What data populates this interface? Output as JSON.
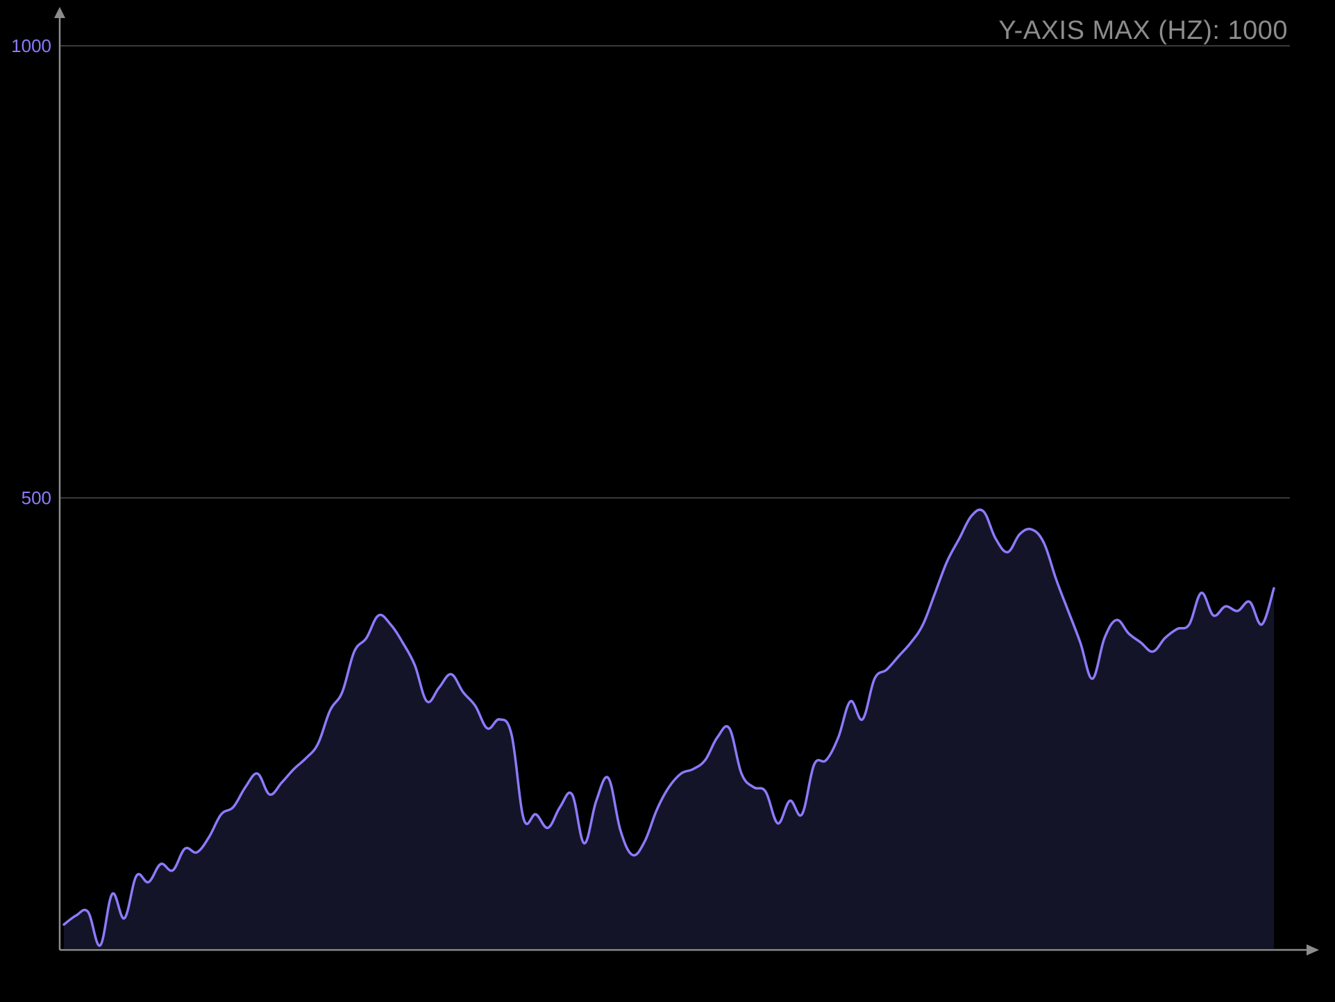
{
  "chart_data": {
    "type": "line",
    "title": "",
    "xlabel": "",
    "ylabel": "",
    "ylim": [
      0,
      1000
    ],
    "yticks": [
      500,
      1000
    ],
    "ytick_labels": [
      "500",
      "1000"
    ],
    "grid": true,
    "legend": "none",
    "annotation": "Y-AXIS MAX (HZ): 1000",
    "colors": {
      "line": "#8b7bff",
      "fill": "#141428",
      "grid": "#3a3a3a",
      "axis": "#8c8c8c",
      "tick_label": "#8b7bff",
      "annotation": "#8c8c8c",
      "background": "#000000"
    },
    "x": [
      0,
      4,
      8,
      12,
      16,
      20,
      24,
      28,
      32,
      36,
      40,
      44,
      48,
      52,
      56,
      60,
      64,
      68,
      72,
      76,
      80,
      84,
      88,
      92,
      96,
      100,
      104,
      108,
      112,
      116,
      120,
      124,
      128,
      132,
      136,
      140,
      144,
      148,
      152,
      156,
      160,
      164,
      168,
      172,
      176,
      180,
      184,
      188,
      192,
      196,
      200,
      204,
      208,
      212,
      216,
      220,
      224,
      228,
      232,
      236,
      240,
      244,
      248,
      252,
      256,
      260,
      264,
      268,
      272,
      276,
      280,
      284,
      288,
      292,
      296,
      300,
      304,
      308,
      312,
      316,
      320,
      324,
      328,
      332,
      336,
      340,
      344,
      348,
      352,
      356,
      360,
      364,
      368,
      372,
      376,
      380,
      384,
      388,
      392,
      396,
      400
    ],
    "series": [
      {
        "values": [
          28,
          38,
          42,
          5,
          62,
          35,
          82,
          75,
          95,
          88,
          112,
          108,
          125,
          150,
          158,
          180,
          195,
          172,
          185,
          200,
          212,
          228,
          265,
          285,
          330,
          345,
          370,
          360,
          340,
          315,
          275,
          290,
          305,
          285,
          270,
          245,
          255,
          238,
          145,
          150,
          135,
          158,
          172,
          118,
          165,
          190,
          132,
          105,
          120,
          155,
          180,
          195,
          200,
          210,
          235,
          245,
          195,
          180,
          175,
          140,
          165,
          150,
          205,
          210,
          235,
          275,
          255,
          300,
          310,
          325,
          340,
          360,
          395,
          430,
          455,
          480,
          485,
          455,
          440,
          460,
          465,
          450,
          410,
          375,
          340,
          300,
          345,
          365,
          350,
          340,
          330,
          345,
          355,
          360,
          395,
          370,
          380,
          375,
          385,
          360,
          400
        ]
      }
    ]
  }
}
